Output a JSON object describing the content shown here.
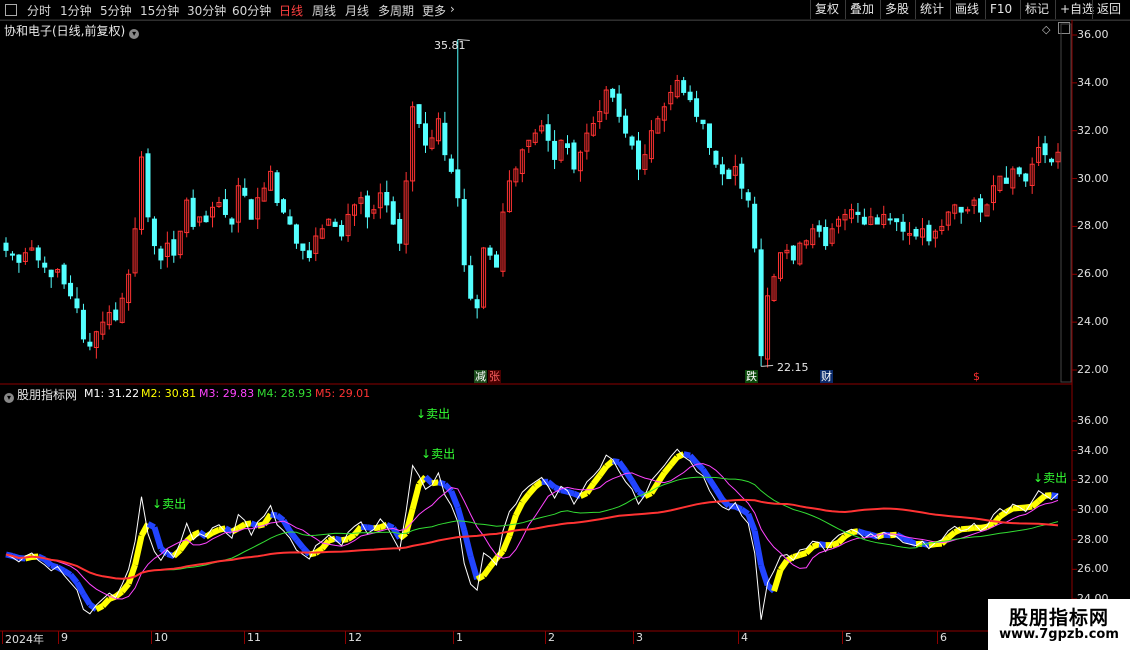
{
  "toolbar": {
    "periods": [
      "分时",
      "1分钟",
      "5分钟",
      "15分钟",
      "30分钟",
      "60分钟",
      "日线",
      "周线",
      "月线",
      "多周期",
      "更多"
    ],
    "active_period": "日线",
    "right_buttons": [
      "复权",
      "叠加",
      "多股",
      "统计",
      "画线",
      "F10",
      "标记",
      "+自选",
      "返回"
    ]
  },
  "main_chart": {
    "title": "协和电子(日线,前复权)",
    "high_label": "35.81",
    "low_label": "22.15",
    "markers": [
      "减",
      "张",
      "跌",
      "财",
      "$"
    ],
    "y_ticks": [
      "36.00",
      "34.00",
      "32.00",
      "30.00",
      "28.00",
      "26.00",
      "24.00",
      "22.00"
    ]
  },
  "indicator": {
    "name": "股朋指标网",
    "lines": [
      {
        "label": "M1: 31.22",
        "color": "#ffffff"
      },
      {
        "label": "M2: 30.81",
        "color": "#ffff00"
      },
      {
        "label": "M3: 29.83",
        "color": "#ff44ff"
      },
      {
        "label": "M4: 28.93",
        "color": "#33dd33"
      },
      {
        "label": "M5: 29.01",
        "color": "#ff3333"
      }
    ],
    "signal_label": "卖出",
    "y_ticks": [
      "36.00",
      "34.00",
      "32.00",
      "30.00",
      "28.00",
      "26.00",
      "24.00"
    ]
  },
  "x_axis": [
    "2024年",
    "9",
    "10",
    "11",
    "12",
    "1",
    "2",
    "3",
    "4",
    "5",
    "6"
  ],
  "watermark": {
    "line1": "股朋指标网",
    "line2": "www.7gpzb.com"
  },
  "colors": {
    "up": "#ff3232",
    "down": "#54ffff",
    "accent": "#ff4040",
    "separator": "#8b0000"
  },
  "chart_data": {
    "type": "candlestick",
    "title": "协和电子(日线,前复权)",
    "x": [
      "2024年",
      "9",
      "10",
      "11",
      "12",
      "1",
      "2",
      "3",
      "4",
      "5",
      "6"
    ],
    "ylim": [
      21.6,
      36.6
    ],
    "annotations": [
      {
        "label": "35.81",
        "value": 35.81
      },
      {
        "label": "22.15",
        "value": 22.15
      }
    ],
    "close": [
      27.0,
      26.8,
      26.5,
      26.9,
      27.1,
      26.6,
      26.3,
      25.9,
      26.2,
      25.6,
      25.1,
      24.6,
      23.3,
      23.0,
      23.6,
      24.0,
      24.4,
      24.1,
      25.0,
      26.0,
      27.9,
      30.9,
      28.4,
      27.2,
      26.6,
      27.3,
      26.8,
      27.8,
      29.1,
      28.0,
      28.4,
      28.2,
      28.8,
      29.0,
      28.5,
      28.1,
      29.7,
      29.3,
      28.3,
      29.2,
      29.6,
      30.3,
      29.0,
      28.6,
      28.1,
      27.3,
      27.0,
      26.7,
      27.6,
      27.9,
      28.3,
      28.0,
      27.6,
      28.5,
      28.9,
      29.2,
      28.4,
      28.7,
      29.4,
      28.9,
      28.1,
      27.3,
      29.9,
      33.0,
      32.3,
      31.4,
      31.7,
      32.5,
      31.0,
      30.3,
      29.2,
      26.4,
      25.0,
      24.6,
      27.1,
      26.8,
      26.3,
      28.6,
      29.9,
      30.4,
      31.2,
      31.6,
      31.9,
      32.2,
      31.6,
      30.8,
      31.6,
      31.3,
      30.4,
      31.1,
      31.9,
      32.3,
      32.8,
      33.7,
      33.4,
      32.6,
      31.9,
      31.4,
      30.4,
      31.0,
      32.0,
      32.5,
      33.0,
      33.6,
      34.1,
      33.6,
      33.3,
      32.6,
      32.3,
      31.3,
      30.6,
      30.2,
      30.0,
      30.5,
      29.6,
      29.1,
      27.1,
      22.6,
      25.1,
      25.9,
      26.9,
      27.0,
      26.6,
      27.3,
      27.4,
      27.9,
      27.8,
      27.2,
      27.9,
      28.3,
      28.5,
      28.7,
      28.5,
      28.1,
      28.4,
      28.1,
      28.5,
      28.3,
      28.2,
      27.8,
      27.7,
      27.6,
      27.9,
      27.4,
      27.8,
      28.0,
      28.6,
      28.9,
      28.6,
      28.7,
      29.1,
      28.6,
      28.9,
      29.7,
      30.1,
      29.8,
      30.4,
      30.2,
      29.9,
      30.6,
      31.3,
      31.0,
      30.7,
      31.1
    ]
  }
}
